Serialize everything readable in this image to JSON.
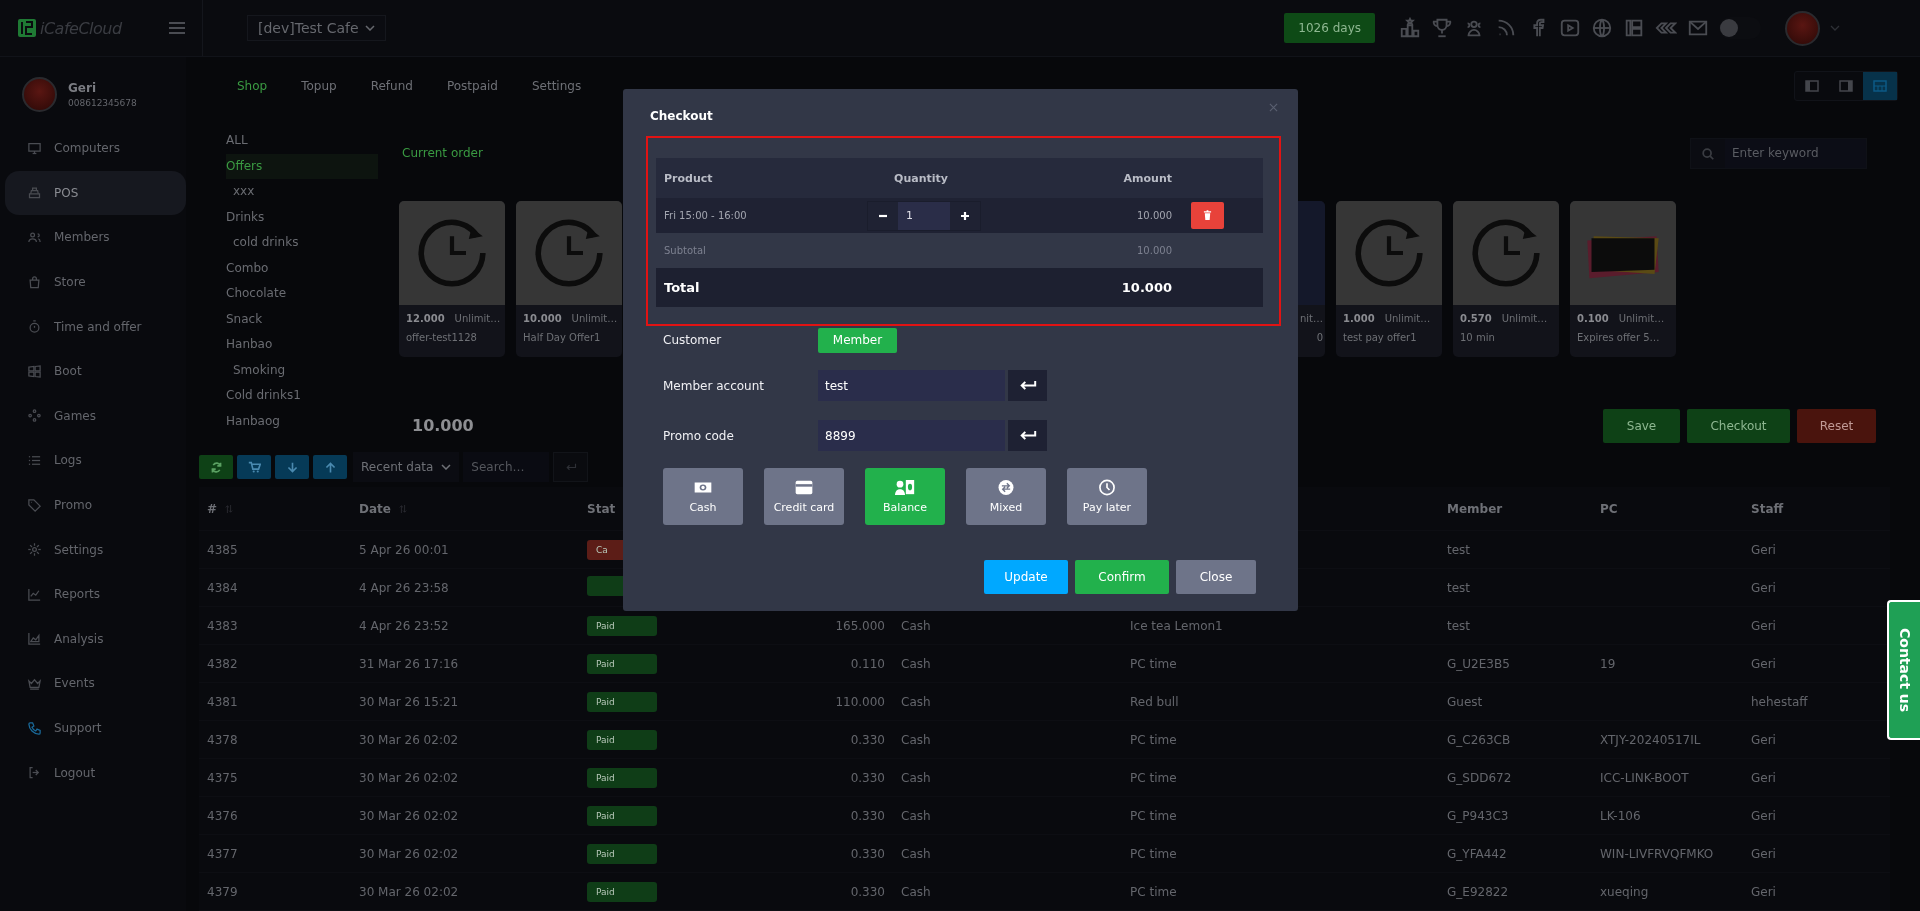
{
  "topbar": {
    "logo": "iCafeCloud",
    "cafe_selector": "[dev]Test Cafe",
    "license": "1026 days",
    "theme_toggle": {
      "on": false
    }
  },
  "user": {
    "name": "Geri",
    "phone": "008612345678"
  },
  "sidebar": {
    "items": [
      {
        "label": "Computers",
        "selected": false
      },
      {
        "label": "POS",
        "selected": true
      },
      {
        "label": "Members",
        "selected": false
      },
      {
        "label": "Store",
        "selected": false
      },
      {
        "label": "Time and offer",
        "selected": false
      },
      {
        "label": "Boot",
        "selected": false
      },
      {
        "label": "Games",
        "selected": false
      },
      {
        "label": "Logs",
        "selected": false
      },
      {
        "label": "Promo",
        "selected": false
      },
      {
        "label": "Settings",
        "selected": false
      },
      {
        "label": "Reports",
        "selected": false
      },
      {
        "label": "Analysis",
        "selected": false
      },
      {
        "label": "Events",
        "selected": false
      },
      {
        "label": "Support",
        "selected": false
      },
      {
        "label": "Logout",
        "selected": false
      }
    ]
  },
  "tabs": [
    {
      "label": "Shop",
      "selected": true
    },
    {
      "label": "Topup",
      "selected": false
    },
    {
      "label": "Refund",
      "selected": false
    },
    {
      "label": "Postpaid",
      "selected": false
    },
    {
      "label": "Settings",
      "selected": false
    }
  ],
  "view_buttons": [
    {
      "selected": false
    },
    {
      "selected": false
    },
    {
      "selected": true
    }
  ],
  "categories": [
    {
      "label": "ALL",
      "selected": false
    },
    {
      "label": "Offers",
      "selected": true,
      "children": [
        {
          "label": "xxx",
          "selected": false
        }
      ]
    },
    {
      "label": "Drinks",
      "selected": false,
      "children": [
        {
          "label": "cold drinks",
          "selected": false
        }
      ]
    },
    {
      "label": "Combo",
      "selected": false
    },
    {
      "label": "Chocolate",
      "selected": false
    },
    {
      "label": "Snack",
      "selected": false
    },
    {
      "label": "Hanbao",
      "selected": false,
      "children": [
        {
          "label": "Smoking",
          "selected": false
        }
      ]
    },
    {
      "label": "Cold drinks1",
      "selected": false
    },
    {
      "label": "Hanbaog",
      "selected": false
    }
  ],
  "current_order_label": "Current order",
  "search": {
    "placeholder": "Enter keyword"
  },
  "products": [
    {
      "kind": "clock",
      "price": "12.000",
      "validity": "Unlimit…",
      "name": "offer-test1128"
    },
    {
      "kind": "clock",
      "price": "10.000",
      "validity": "Unlimit…",
      "name": "Half Day Offer1"
    },
    {
      "kind": "stub",
      "validity": "nit…",
      "name": "0"
    },
    {
      "kind": "clock",
      "price": "1.000",
      "validity": "Unlimit…",
      "name": "test pay offer1"
    },
    {
      "kind": "clock",
      "price": "0.570",
      "validity": "Unlimit…",
      "name": "10 min"
    },
    {
      "kind": "banner",
      "price": "0.100",
      "validity": "Unlimit…",
      "name": "Expires offer 5…"
    }
  ],
  "order_total": "10.000",
  "order_actions": [
    {
      "label": "Save",
      "kind": "success"
    },
    {
      "label": "Checkout",
      "kind": "success"
    },
    {
      "label": "Reset",
      "kind": "danger"
    }
  ],
  "toolbar": {
    "range_select": "Recent data",
    "search_placeholder": "Search…"
  },
  "table": {
    "columns": [
      {
        "label": "#",
        "sortable": true
      },
      {
        "label": "Date",
        "sortable": true
      },
      {
        "label": "Stat"
      },
      {
        "label": "Member",
        "sortable": false
      },
      {
        "label": "PC",
        "sortable": false
      },
      {
        "label": "Staff",
        "sortable": false
      }
    ],
    "rows": [
      {
        "id": "4385",
        "date": "5 Apr 26 00:01",
        "status": {
          "text": "Ca",
          "color": "#5c1d17"
        },
        "member": "test",
        "staff": "Geri"
      },
      {
        "id": "4384",
        "date": "4 Apr 26 23:58",
        "status": {
          "color": "#0f3d17"
        },
        "member": "test",
        "staff": "Geri"
      },
      {
        "id": "4383",
        "date": "4 Apr 26 23:52",
        "status": {
          "text": "Paid",
          "color": "#0f3d17"
        },
        "amount": "165.000",
        "payment": "Cash",
        "item": "Ice tea Lemon1",
        "member": "test",
        "staff": "Geri"
      },
      {
        "id": "4382",
        "date": "31 Mar 26 17:16",
        "status": {
          "text": "Paid",
          "color": "#0f3d17"
        },
        "amount": "0.110",
        "payment": "Cash",
        "item": "PC time",
        "member": "G_U2E3B5",
        "pc": "19",
        "staff": "Geri"
      },
      {
        "id": "4381",
        "date": "30 Mar 26 15:21",
        "status": {
          "text": "Paid",
          "color": "#0f3d17"
        },
        "amount": "110.000",
        "payment": "Cash",
        "item": "Red bull",
        "member": "Guest",
        "staff": "hehestaff"
      },
      {
        "id": "4378",
        "date": "30 Mar 26 02:02",
        "status": {
          "text": "Paid",
          "color": "#0f3d17"
        },
        "amount": "0.330",
        "payment": "Cash",
        "item": "PC time",
        "member": "G_C263CB",
        "pc": "XTJY-20240517IL",
        "staff": "Geri"
      },
      {
        "id": "4375",
        "date": "30 Mar 26 02:02",
        "status": {
          "text": "Paid",
          "color": "#0f3d17"
        },
        "amount": "0.330",
        "payment": "Cash",
        "item": "PC time",
        "member": "G_SDD672",
        "pc": "ICC-LINK-BOOT",
        "staff": "Geri"
      },
      {
        "id": "4376",
        "date": "30 Mar 26 02:02",
        "status": {
          "text": "Paid",
          "color": "#0f3d17"
        },
        "amount": "0.330",
        "payment": "Cash",
        "item": "PC time",
        "member": "G_P943C3",
        "pc": "LK-106",
        "staff": "Geri"
      },
      {
        "id": "4377",
        "date": "30 Mar 26 02:02",
        "status": {
          "text": "Paid",
          "color": "#0f3d17"
        },
        "amount": "0.330",
        "payment": "Cash",
        "item": "PC time",
        "member": "G_YFA442",
        "pc": "WIN-LIVFRVQFMKO",
        "staff": "Geri"
      },
      {
        "id": "4379",
        "date": "30 Mar 26 02:02",
        "status": {
          "text": "Paid",
          "color": "#0f3d17"
        },
        "amount": "0.330",
        "payment": "Cash",
        "item": "PC time",
        "member": "G_E92822",
        "pc": "xueqing",
        "staff": "Geri"
      }
    ]
  },
  "modal": {
    "title": "Checkout",
    "order": {
      "columns": [
        "Product",
        "Quantity",
        "Amount"
      ],
      "items": [
        {
          "product": "Fri 15:00 - 16:00",
          "quantity": "1",
          "amount": "10.000"
        }
      ],
      "subtotal_label": "Subtotal",
      "subtotal": "10.000",
      "total_label": "Total",
      "total": "10.000"
    },
    "customer": {
      "label": "Customer",
      "value": "Member"
    },
    "member_account": {
      "label": "Member account",
      "value": "test"
    },
    "promo_code": {
      "label": "Promo code",
      "value": "8899"
    },
    "payment_methods": [
      {
        "label": "Cash",
        "selected": false
      },
      {
        "label": "Credit card",
        "selected": false
      },
      {
        "label": "Balance",
        "selected": true
      },
      {
        "label": "Mixed",
        "selected": false
      },
      {
        "label": "Pay later",
        "selected": false
      }
    ],
    "buttons": [
      {
        "label": "Update",
        "kind": "info"
      },
      {
        "label": "Confirm",
        "kind": "success"
      },
      {
        "label": "Close",
        "kind": "secondary"
      }
    ]
  },
  "contact_tab": "Contact us"
}
